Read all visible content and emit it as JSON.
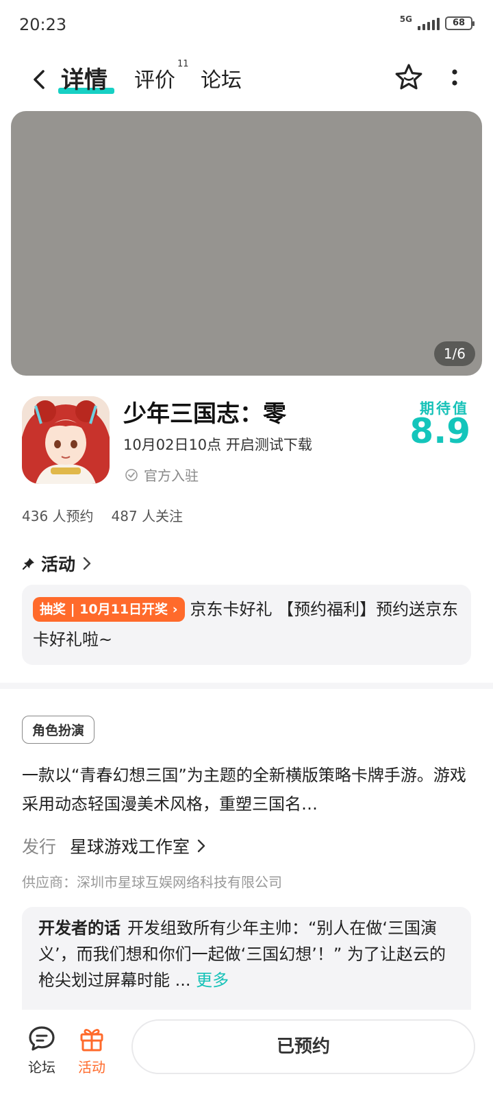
{
  "status_bar": {
    "time": "20:23",
    "network": "5G",
    "battery": "68"
  },
  "nav": {
    "tabs": [
      {
        "label": "详情"
      },
      {
        "label": "评价",
        "badge": "11"
      },
      {
        "label": "论坛"
      }
    ]
  },
  "banner": {
    "counter": "1/6"
  },
  "game": {
    "title": "少年三国志：零",
    "test_date": "10月02日10点 开启测试下载",
    "official": "官方入驻",
    "expect_label": "期待值",
    "expect_score": "8.9",
    "reservations": "436 人预约",
    "follows": "487 人关注"
  },
  "activity": {
    "header": "活动",
    "badge": "抽奖 | 10月11日开奖",
    "text": "京东卡好礼 【预约福利】预约送京东卡好礼啦~"
  },
  "info": {
    "tag": "角色扮演",
    "description": "一款以“青春幻想三国”为主题的全新横版策略卡牌手游。游戏采用动态轻国漫美术风格，重塑三国名…",
    "publisher_label": "发行",
    "publisher_name": "星球游戏工作室",
    "supplier": "供应商：深圳市星球互娱网络科技有限公司"
  },
  "developer": {
    "label": "开发者的话",
    "text": "开发组致所有少年主帅：“别人在做‘三国演义’，而我们想和你们一起做‘三国幻想’！” 为了让赵云的枪尖划过屏幕时能 ...",
    "more": "更多"
  },
  "bottom": {
    "forum_label": "论坛",
    "activity_label": "活动",
    "reserve_label": "已预约"
  },
  "colors": {
    "accent": "#17c2b8",
    "orange": "#ff6a2b"
  }
}
